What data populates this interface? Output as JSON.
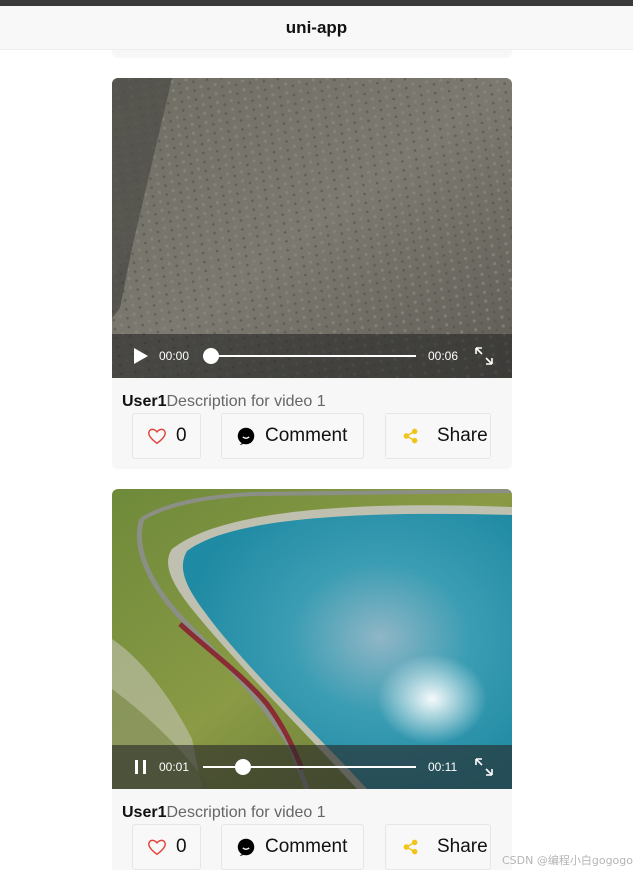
{
  "navbar": {
    "title": "uni-app"
  },
  "videos": [
    {
      "user": "User1",
      "description": "Description for video 1",
      "state": "paused",
      "control_icon": "play-icon",
      "current_time": "00:00",
      "duration": "00:06",
      "progress": 0.0,
      "likes": "0",
      "comment_label": "Comment",
      "share_label": "Share"
    },
    {
      "user": "User1",
      "description": "Description for video 1",
      "state": "playing",
      "control_icon": "pause-icon",
      "current_time": "00:01",
      "duration": "00:11",
      "progress": 0.15,
      "likes": "0",
      "comment_label": "Comment",
      "share_label": "Share"
    }
  ],
  "colors": {
    "like": "#e0453a",
    "share": "#f0c419",
    "comment": "#000000",
    "navbar_bg": "#f8f8f8"
  },
  "watermark": "CSDN @编程小白gogogo"
}
